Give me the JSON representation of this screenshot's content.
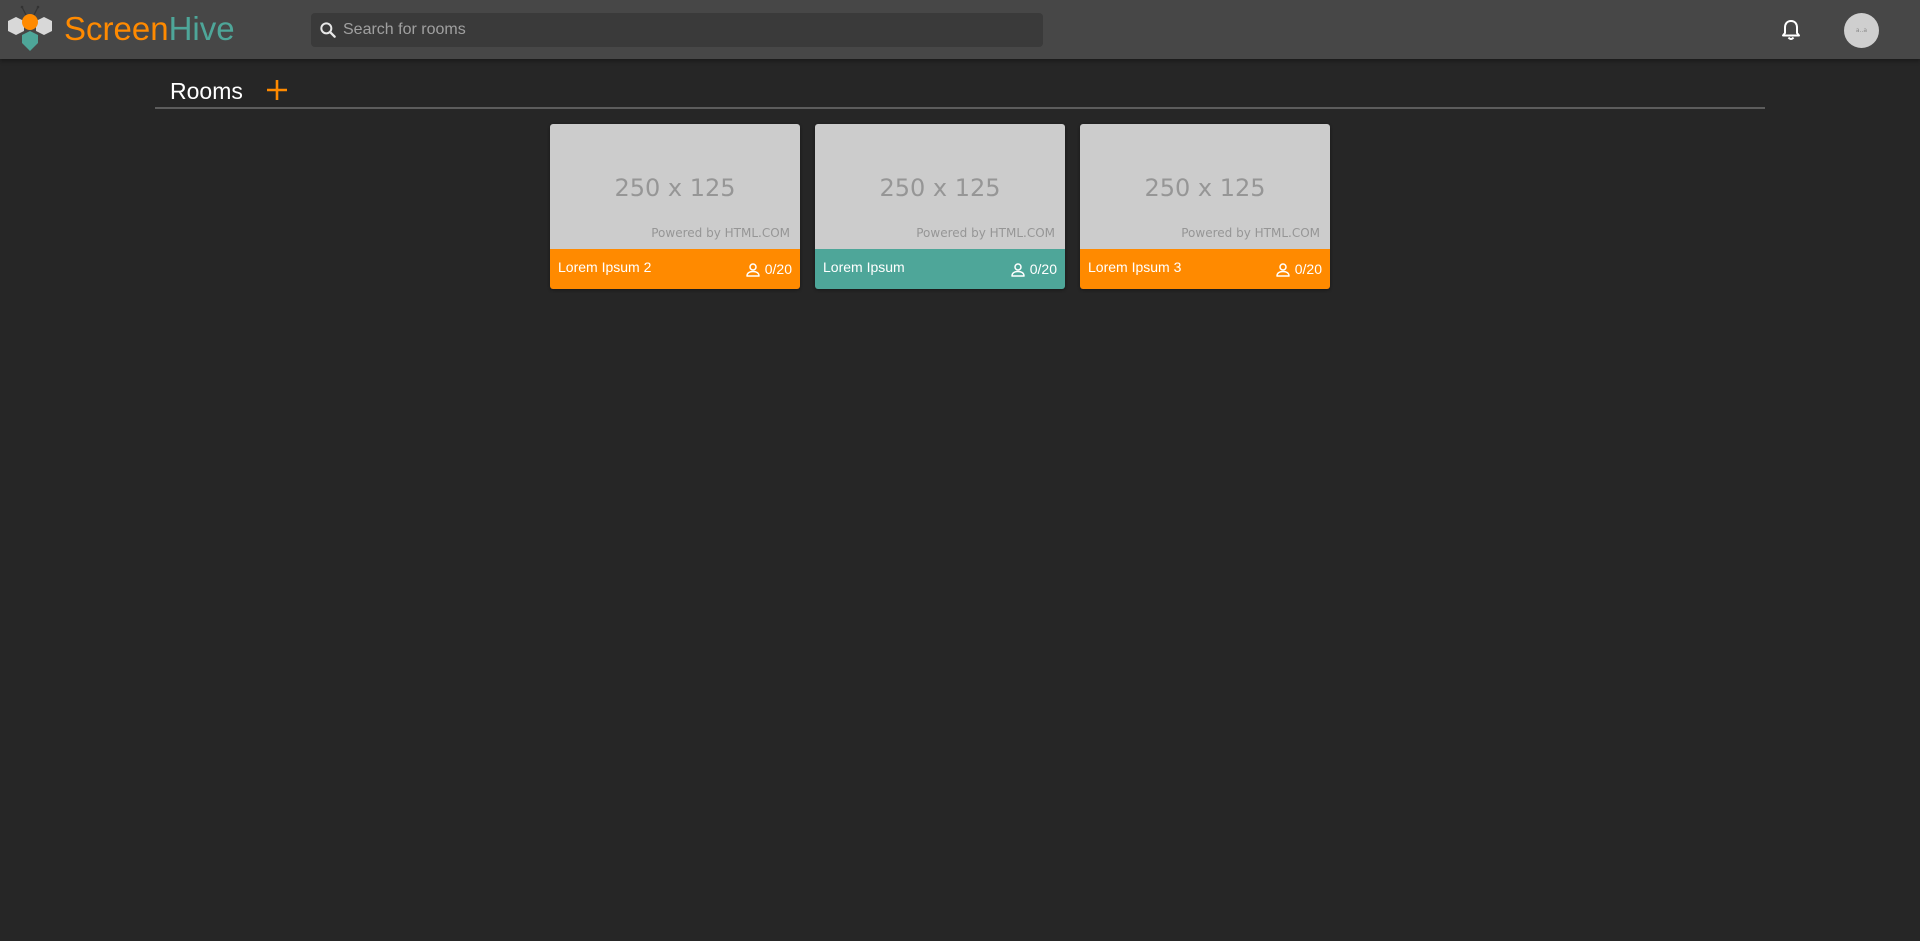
{
  "app": {
    "brand_part1": "Screen",
    "brand_part2": "Hive",
    "brand_color1": "#ff8a00",
    "brand_color2": "#4ea699"
  },
  "header": {
    "search_placeholder": "Search for rooms",
    "search_value": "",
    "notification_icon": "bell-icon",
    "avatar_text": "a..a"
  },
  "section": {
    "title": "Rooms",
    "add_icon": "plus-icon"
  },
  "rooms": [
    {
      "name": "Lorem Ipsum 2",
      "occupancy": "0/20",
      "color": "#ff8a00",
      "thumb_text": "250 x 125",
      "thumb_credit": "Powered by HTML.COM"
    },
    {
      "name": "Lorem Ipsum",
      "occupancy": "0/20",
      "color": "#4ea699",
      "thumb_text": "250 x 125",
      "thumb_credit": "Powered by HTML.COM"
    },
    {
      "name": "Lorem Ipsum 3",
      "occupancy": "0/20",
      "color": "#ff8a00",
      "thumb_text": "250 x 125",
      "thumb_credit": "Powered by HTML.COM"
    }
  ]
}
